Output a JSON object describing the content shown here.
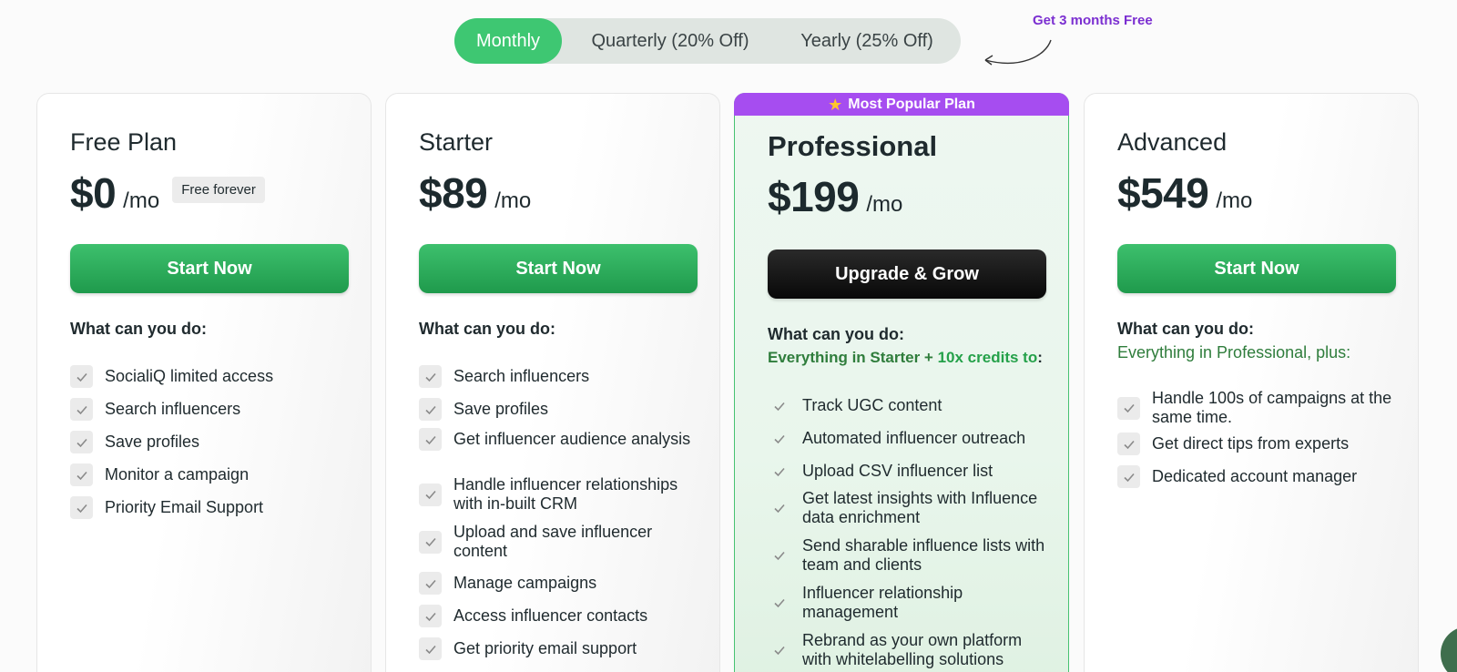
{
  "billing": {
    "options": [
      "Monthly",
      "Quarterly (20% Off)",
      "Yearly (25% Off)"
    ],
    "selected": "Monthly",
    "promo": "Get 3 months Free"
  },
  "plans": [
    {
      "name": "Free Plan",
      "price": "$0",
      "period": "/mo",
      "badge": "Free forever",
      "cta": "Start Now",
      "what_label": "What can you do:",
      "features": [
        "SocialiQ limited access",
        "Search influencers",
        "Save profiles",
        "Monitor a campaign",
        "Priority Email Support"
      ]
    },
    {
      "name": "Starter",
      "price": "$89",
      "period": "/mo",
      "cta": "Start Now",
      "what_label": "What can you do:",
      "features": [
        "Search influencers",
        "Save profiles",
        "Get influencer audience analysis",
        "Handle influencer relationships with in-built CRM",
        "Upload and save influencer content",
        "Manage campaigns",
        "Access influencer contacts",
        "Get priority email support"
      ]
    },
    {
      "name": "Professional",
      "ribbon": "Most Popular Plan",
      "price": "$199",
      "period": "/mo",
      "cta": "Upgrade & Grow",
      "what_label": "What can you do:",
      "extra_parts": [
        "Everything in Starter + ",
        "10x credits to",
        ":"
      ],
      "features": [
        "Track UGC content",
        "Automated influencer outreach",
        "Upload CSV influencer list",
        "Get latest insights with Influence data enrichment",
        "Send sharable influence lists with team and clients",
        "Influencer relationship management",
        "Rebrand as your own platform with whitelabelling solutions"
      ]
    },
    {
      "name": "Advanced",
      "price": "$549",
      "period": "/mo",
      "cta": "Start Now",
      "what_label": "What can you do:",
      "extra": "Everything in Professional, plus:",
      "features": [
        "Handle 100s of campaigns at the same time.",
        "Get direct tips from experts",
        "Dedicated account manager"
      ]
    }
  ],
  "colors": {
    "green": "#3ec772",
    "purple": "#a64df0",
    "dark_button": "#0f0f0f"
  },
  "icons": [
    "check-icon",
    "star-icon",
    "curved-arrow-icon"
  ]
}
